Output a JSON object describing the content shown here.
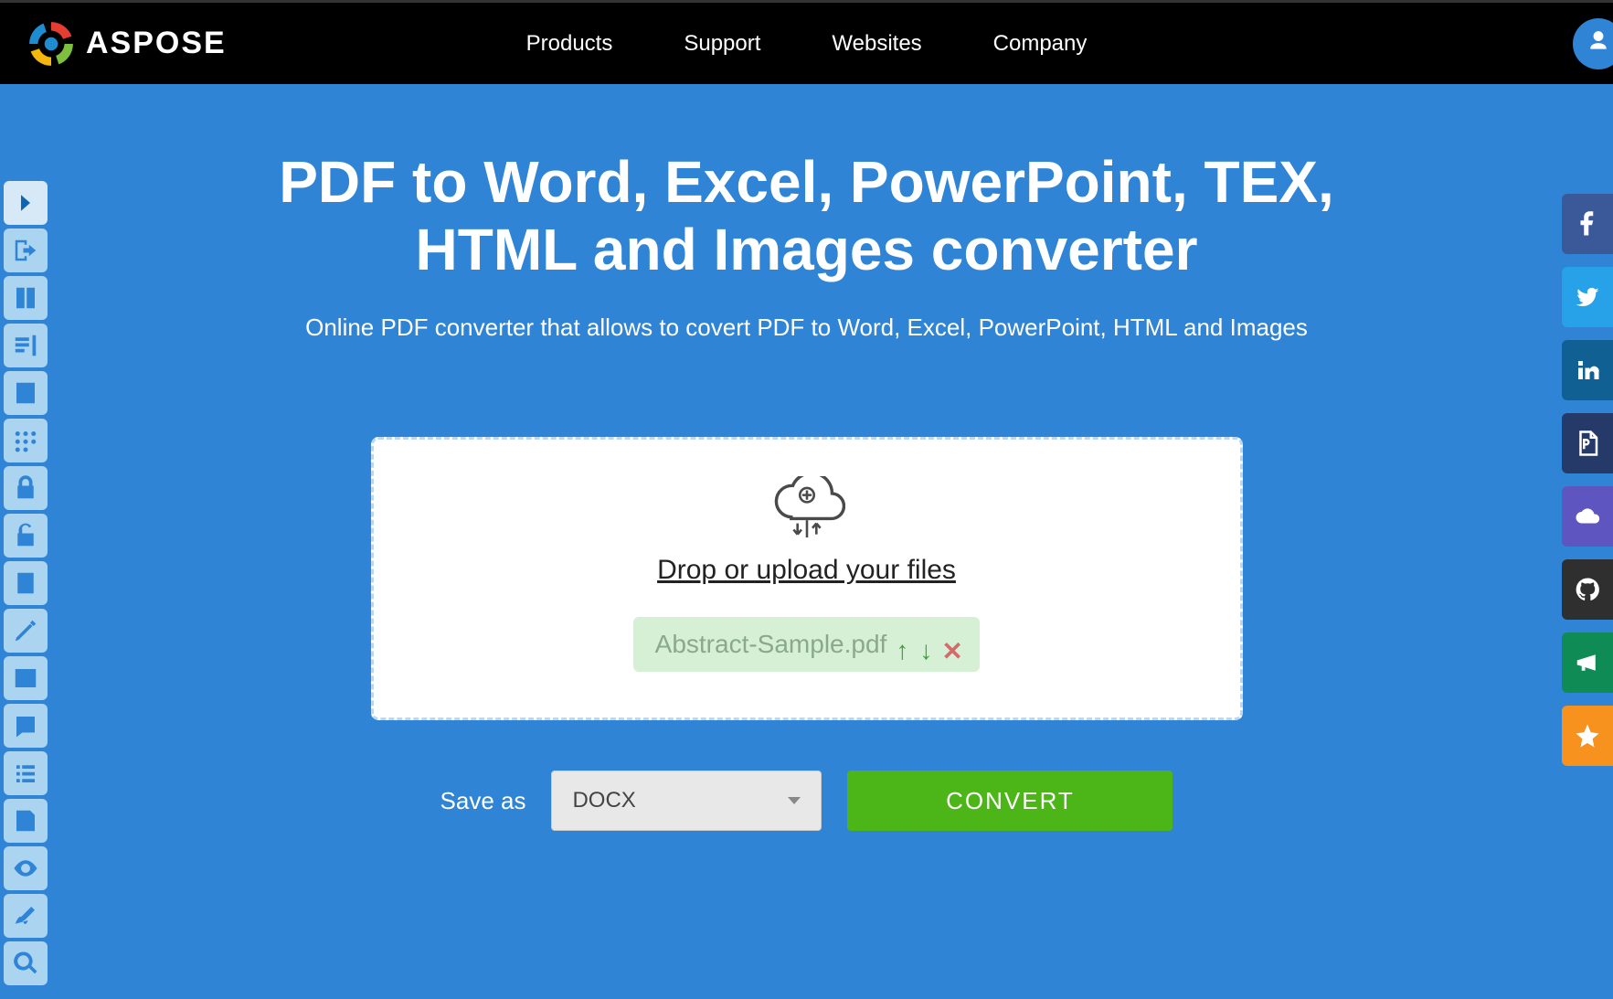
{
  "brand": {
    "name": "ASPOSE"
  },
  "nav": {
    "items": [
      "Products",
      "Support",
      "Websites",
      "Company"
    ]
  },
  "hero": {
    "title_line1": "PDF to Word, Excel, PowerPoint, TEX,",
    "title_line2": "HTML and Images converter",
    "subtitle": "Online PDF converter that allows to covert PDF to Word, Excel, PowerPoint, HTML and Images"
  },
  "dropzone": {
    "label": "Drop or upload your files",
    "file_name": "Abstract-Sample.pdf"
  },
  "actions": {
    "save_as_label": "Save as",
    "format_selected": "DOCX",
    "convert_label": "CONVERT"
  },
  "left_tools": [
    "expand",
    "import",
    "split",
    "parse",
    "form",
    "redact",
    "lock",
    "unlock",
    "compress",
    "edit",
    "image",
    "annotate",
    "list",
    "extract",
    "view",
    "sign",
    "search"
  ],
  "social": [
    {
      "name": "facebook",
      "color": "c-fb"
    },
    {
      "name": "twitter",
      "color": "c-tw"
    },
    {
      "name": "linkedin",
      "color": "c-in"
    },
    {
      "name": "pdf",
      "color": "c-pdf"
    },
    {
      "name": "cloud",
      "color": "c-cl"
    },
    {
      "name": "github",
      "color": "c-gh"
    },
    {
      "name": "megaphone",
      "color": "c-mg"
    },
    {
      "name": "star",
      "color": "c-st"
    }
  ]
}
